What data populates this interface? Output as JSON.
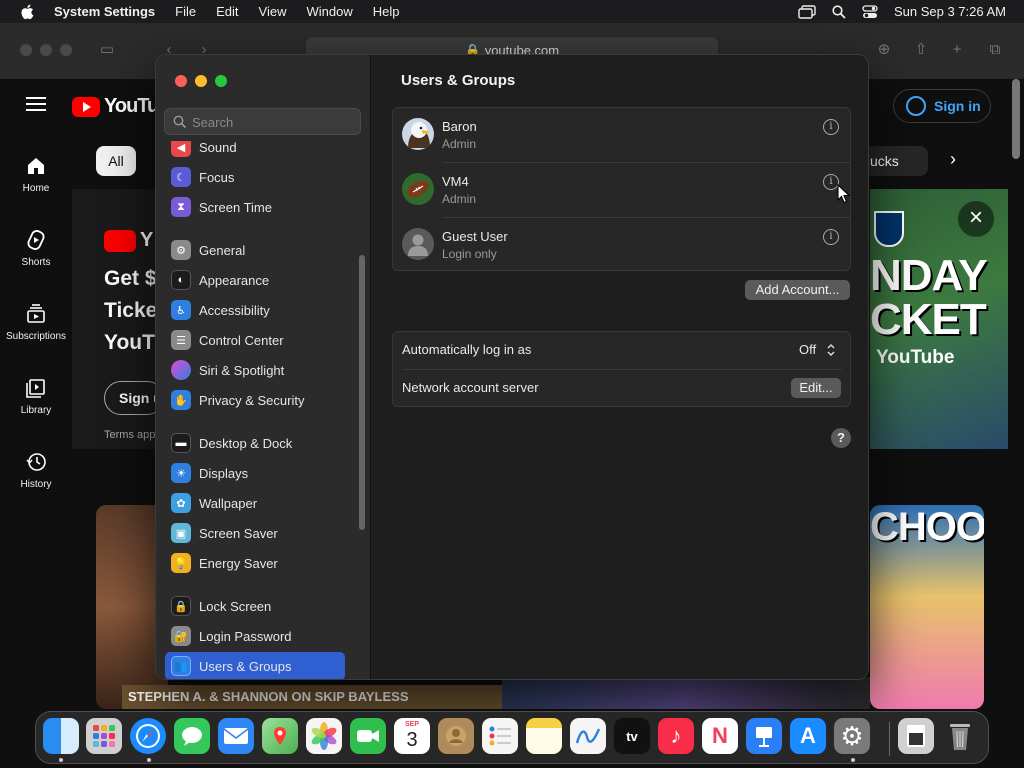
{
  "menubar": {
    "app_name": "System Settings",
    "menus": [
      "File",
      "Edit",
      "View",
      "Window",
      "Help"
    ],
    "clock": "Sun Sep 3  7:26 AM"
  },
  "safari": {
    "url": "youtube.com"
  },
  "youtube": {
    "logo_text": "YouTube",
    "sidebar": [
      {
        "label": "Home",
        "icon": "home-icon"
      },
      {
        "label": "Shorts",
        "icon": "shorts-icon"
      },
      {
        "label": "Subscriptions",
        "icon": "subscriptions-icon"
      },
      {
        "label": "Library",
        "icon": "library-icon"
      },
      {
        "label": "History",
        "icon": "history-icon"
      }
    ],
    "chip_all": "All",
    "chip_right": "ucks",
    "sign_in": "Sign in",
    "banner_lines": [
      "Get $",
      "Ticke",
      "YouT"
    ],
    "banner_sign": "Sign u",
    "banner_terms": "Terms app",
    "right_banner_lines": [
      "NDAY",
      "CKET"
    ],
    "right_banner_yt": "YouTube",
    "right_thumb_text": "CHOOL",
    "bottom_strip_text": "STEPHEN A. & SHANNON ON SKIP BAYLESS"
  },
  "settings": {
    "search_placeholder": "Search",
    "sidebar_items": [
      {
        "label": "Sound",
        "color": "#e5484d",
        "top": 0
      },
      {
        "label": "Focus",
        "color": "#5b5bd6"
      },
      {
        "label": "Screen Time",
        "color": "#7a5bd6"
      },
      {
        "label": "General",
        "color": "#8a8a8a"
      },
      {
        "label": "Appearance",
        "color": "#1c1c1c"
      },
      {
        "label": "Accessibility",
        "color": "#2f7fe0"
      },
      {
        "label": "Control Center",
        "color": "#8a8a8a"
      },
      {
        "label": "Siri & Spotlight",
        "color": "#b04ad6"
      },
      {
        "label": "Privacy & Security",
        "color": "#2f7fe0"
      },
      {
        "label": "Desktop & Dock",
        "color": "#1c1c1c"
      },
      {
        "label": "Displays",
        "color": "#2f7fe0"
      },
      {
        "label": "Wallpaper",
        "color": "#3fa0e0"
      },
      {
        "label": "Screen Saver",
        "color": "#5fb8d8"
      },
      {
        "label": "Energy Saver",
        "color": "#f0b020"
      },
      {
        "label": "Lock Screen",
        "color": "#1c1c1c"
      },
      {
        "label": "Login Password",
        "color": "#8a8a8a"
      },
      {
        "label": "Users & Groups",
        "color": "#2f7fe0"
      }
    ],
    "title": "Users & Groups",
    "users": [
      {
        "name": "Baron",
        "role": "Admin"
      },
      {
        "name": "VM4",
        "role": "Admin"
      },
      {
        "name": "Guest User",
        "role": "Login only"
      }
    ],
    "add_account": "Add Account...",
    "auto_login_label": "Automatically log in as",
    "auto_login_value": "Off",
    "network_label": "Network account server",
    "edit_label": "Edit...",
    "help_label": "?"
  },
  "dock": {
    "apps": [
      {
        "name": "Finder",
        "color": "#2a8cf0",
        "glyph": ""
      },
      {
        "name": "Launchpad",
        "color": "#d0d0d0",
        "glyph": ""
      },
      {
        "name": "Safari",
        "color": "#1a8cff",
        "glyph": ""
      },
      {
        "name": "Messages",
        "color": "#34c759",
        "glyph": ""
      },
      {
        "name": "Mail",
        "color": "#2f87f5",
        "glyph": ""
      },
      {
        "name": "Maps",
        "color": "#4caf50",
        "glyph": ""
      },
      {
        "name": "Photos",
        "color": "#f5f5f5",
        "glyph": ""
      },
      {
        "name": "FaceTime",
        "color": "#2fbf4f",
        "glyph": ""
      },
      {
        "name": "Calendar",
        "color": "#ffffff",
        "glyph": "3"
      },
      {
        "name": "Contacts",
        "color": "#b08a5a",
        "glyph": ""
      },
      {
        "name": "Reminders",
        "color": "#f5f5f5",
        "glyph": ""
      },
      {
        "name": "Notes",
        "color": "#f7d046",
        "glyph": ""
      },
      {
        "name": "Freeform",
        "color": "#f5f5f5",
        "glyph": ""
      },
      {
        "name": "TV",
        "color": "#111111",
        "glyph": "tv"
      },
      {
        "name": "Music",
        "color": "#fa2d48",
        "glyph": "♪"
      },
      {
        "name": "News",
        "color": "#f43f5e",
        "glyph": "N"
      },
      {
        "name": "Keynote",
        "color": "#2a7ff5",
        "glyph": ""
      },
      {
        "name": "App Store",
        "color": "#1a8cff",
        "glyph": "A"
      },
      {
        "name": "System Settings",
        "color": "#7a7a7a",
        "glyph": "⚙"
      },
      {
        "name": "Preview",
        "color": "#d0d0d0",
        "glyph": ""
      },
      {
        "name": "Trash",
        "color": "#9a9a9a",
        "glyph": ""
      }
    ],
    "calendar_month": "SEP"
  }
}
